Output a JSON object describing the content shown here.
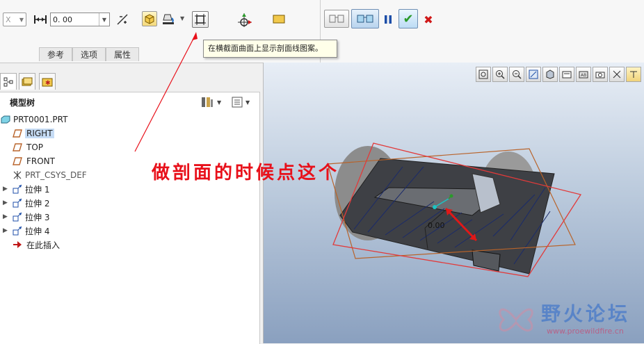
{
  "toolbar": {
    "axis_select": "X",
    "offset_value": "0. 00",
    "confirm_symbol": "✔",
    "cancel_symbol": "✖"
  },
  "tabs": [
    "参考",
    "选项",
    "属性"
  ],
  "tooltip": "在横截面曲面上显示剖面线图案。",
  "model_tree": {
    "title": "模型树",
    "items": [
      {
        "label": "PRT0001.PRT"
      },
      {
        "label": "RIGHT"
      },
      {
        "label": "TOP"
      },
      {
        "label": "FRONT"
      },
      {
        "label": "PRT_CSYS_DEF"
      },
      {
        "label": "拉伸 1"
      },
      {
        "label": "拉伸 2"
      },
      {
        "label": "拉伸 3"
      },
      {
        "label": "拉伸 4"
      },
      {
        "label": "在此插入"
      }
    ]
  },
  "graphics": {
    "dimension_label": "0.00"
  },
  "annotation": "做剖面的时候点这个",
  "watermark": {
    "title": "野火论坛",
    "url": "www.proewildfire.cn"
  },
  "colors": {
    "annotation_red": "#e8101a",
    "tooltip_bg": "#ffffe9",
    "confirm_green": "#2a9a2a",
    "cancel_red": "#d01818",
    "pause_blue": "#1d4ea8",
    "selection_highlight": "#c6dcf5"
  }
}
